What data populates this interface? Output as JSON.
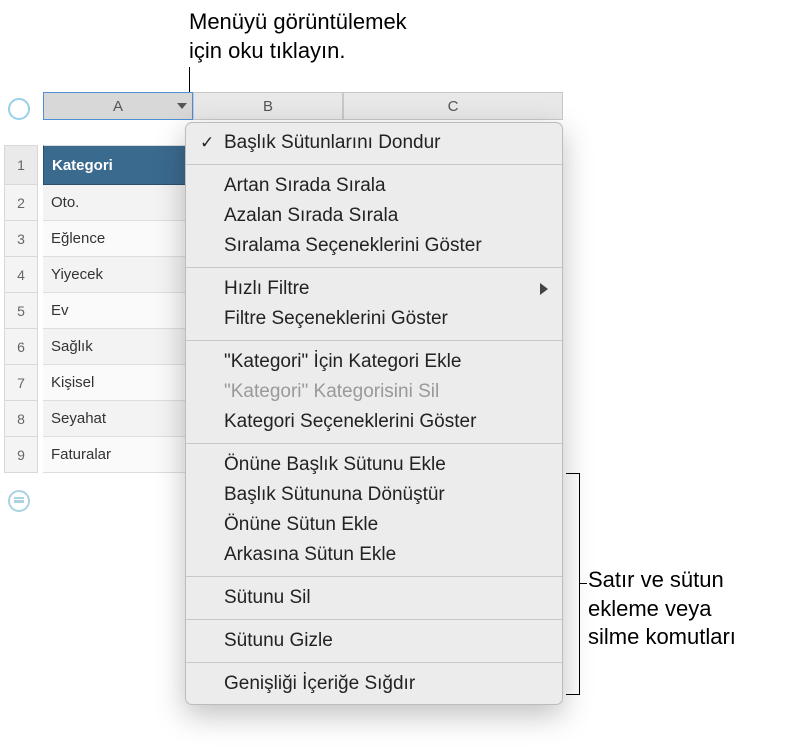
{
  "annotations": {
    "top": "Menüyü görüntülemek\niçin oku tıklayın.",
    "top_line1": "Menüyü görüntülemek",
    "top_line2": "için oku tıklayın.",
    "right_line1": "Satır ve sütun",
    "right_line2": "ekleme veya",
    "right_line3": "silme komutları"
  },
  "columns": {
    "a": "A",
    "b": "B",
    "c": "C"
  },
  "rows": {
    "r1": "1",
    "r2": "2",
    "r3": "3",
    "r4": "4",
    "r5": "5",
    "r6": "6",
    "r7": "7",
    "r8": "8",
    "r9": "9"
  },
  "cells": {
    "header": "Kategori",
    "r2": "Oto.",
    "r3": "Eğlence",
    "r4": "Yiyecek",
    "r5": "Ev",
    "r6": "Sağlık",
    "r7": "Kişisel",
    "r8": "Seyahat",
    "r9": "Faturalar"
  },
  "menu": {
    "freeze": "Başlık Sütunlarını Dondur",
    "sort_asc": "Artan Sırada Sırala",
    "sort_desc": "Azalan Sırada Sırala",
    "sort_options": "Sıralama Seçeneklerini Göster",
    "quick_filter": "Hızlı Filtre",
    "filter_options": "Filtre Seçeneklerini Göster",
    "add_category": "\"Kategori\" İçin Kategori Ekle",
    "delete_category": "\"Kategori\" Kategorisini Sil",
    "category_options": "Kategori Seçeneklerini Göster",
    "add_header_before": "Önüne Başlık Sütunu Ekle",
    "convert_to_header": "Başlık Sütununa Dönüştür",
    "add_col_before": "Önüne Sütun Ekle",
    "add_col_after": "Arkasına Sütun Ekle",
    "delete_col": "Sütunu Sil",
    "hide_col": "Sütunu Gizle",
    "fit_width": "Genişliği İçeriğe Sığdır"
  }
}
